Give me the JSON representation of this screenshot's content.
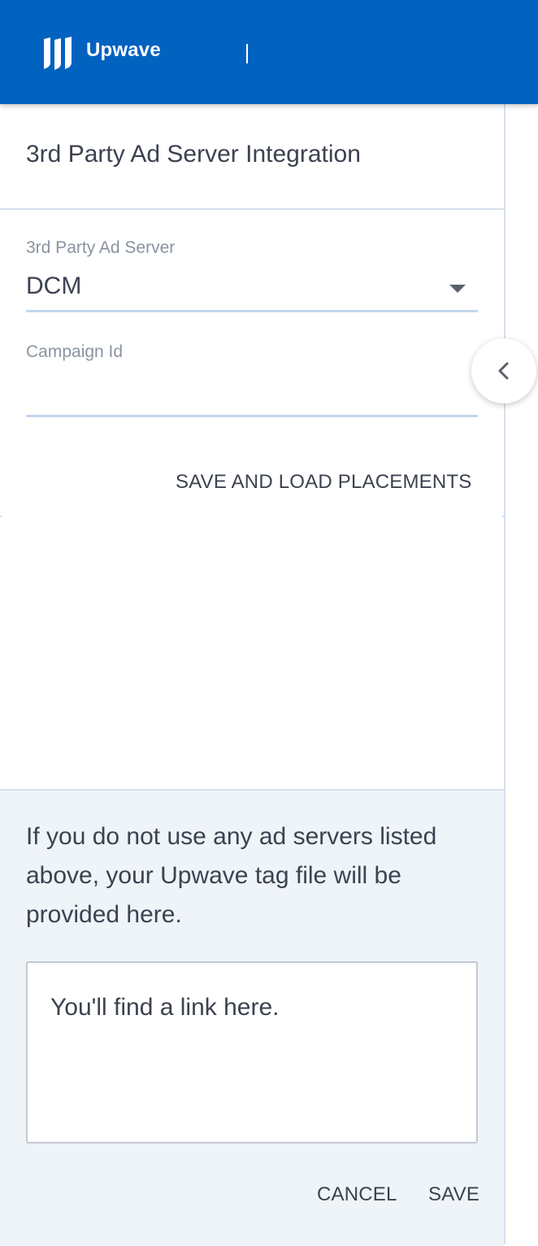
{
  "header": {
    "brand": "Upwave",
    "brand_color": "#0162c0"
  },
  "panel": {
    "title": "3rd Party Ad Server Integration"
  },
  "form": {
    "ad_server_label": "3rd Party Ad Server",
    "ad_server_value": "DCM",
    "campaign_label": "Campaign Id",
    "campaign_value": "",
    "save_load_label": "SAVE AND LOAD PLACEMENTS"
  },
  "footer": {
    "note": "If you do not use any ad servers listed above, your Upwave tag file will be provided here.",
    "link_placeholder": "You'll find a link here.",
    "cancel_label": "CANCEL",
    "save_label": "SAVE"
  },
  "icons": {
    "logo": "upwave-logo-icon",
    "caret": "caret-down-icon",
    "collapse": "chevron-left-icon"
  }
}
